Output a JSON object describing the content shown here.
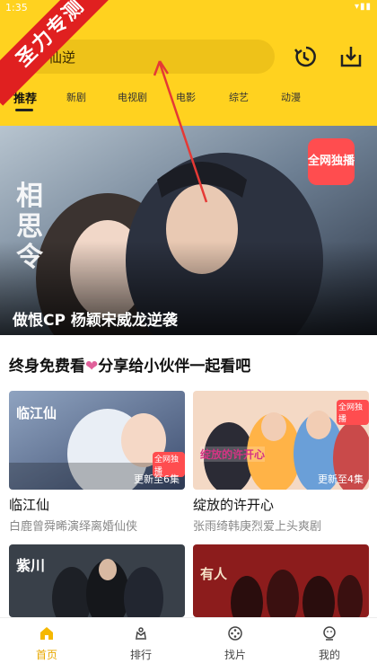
{
  "status": {
    "time": "1:35",
    "icons": "▾▮▮"
  },
  "watermark": "圣力专测",
  "search": {
    "value": "仙逆"
  },
  "header_icons": [
    "history-icon",
    "download-icon"
  ],
  "tabs": [
    {
      "label": "推荐",
      "active": true
    },
    {
      "label": "新剧"
    },
    {
      "label": "电视剧"
    },
    {
      "label": "电影"
    },
    {
      "label": "综艺"
    },
    {
      "label": "动漫"
    }
  ],
  "banner": {
    "caption": "做恨CP 杨颖宋威龙逆袭",
    "badge": "全网独播",
    "poster_title": "相思令",
    "slides": 5,
    "active_slide": 4
  },
  "promo": {
    "text_before": "终身免费看",
    "text_after": "分享给小伙伴一起看吧"
  },
  "cards": [
    {
      "title": "临江仙",
      "subtitle": "白鹿曾舜晞演绎离婚仙侠",
      "episode": "更新至6集",
      "poster_text": "临江仙",
      "badge": "全网独播"
    },
    {
      "title": "绽放的许开心",
      "subtitle": "张雨绮韩庚烈爱上头爽剧",
      "episode": "更新至4集",
      "poster_text": "绽放的许开心",
      "badge": "全网独播"
    },
    {
      "title": "",
      "subtitle": "",
      "episode": "",
      "poster_text": "紫川"
    },
    {
      "title": "",
      "subtitle": "",
      "episode": "",
      "poster_text": "有人"
    }
  ],
  "nav": [
    {
      "label": "首页",
      "icon": "home-icon",
      "active": true
    },
    {
      "label": "排行",
      "icon": "ranking-icon"
    },
    {
      "label": "找片",
      "icon": "discover-icon"
    },
    {
      "label": "我的",
      "icon": "profile-icon"
    }
  ],
  "colors": {
    "brand": "#FFD21F",
    "active_nav": "#E8A800",
    "watermark": "#E02020",
    "heart": "#E0609A"
  }
}
